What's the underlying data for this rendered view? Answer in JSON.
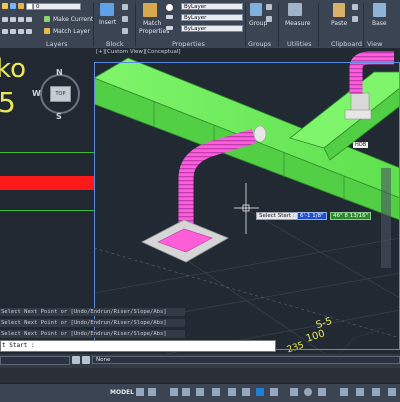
{
  "ribbon": {
    "layer_name": "0",
    "make_current": "Make Current",
    "match_layer": "Match Layer",
    "panel_layers": "Layers",
    "insert": "Insert",
    "panel_block": "Block",
    "match_properties_line1": "Match",
    "match_properties_line2": "Properties",
    "color_value": "ByLayer",
    "linetype_value": "ByLayer",
    "lineweight_value": "ByLayer",
    "panel_properties": "Properties",
    "group": "Group",
    "panel_groups": "Groups",
    "measure": "Measure",
    "panel_utilities": "Utilities",
    "paste": "Paste",
    "panel_clipboard": "Clipboard",
    "base": "Base",
    "panel_view": "View"
  },
  "left_panel": {
    "text_line1": "ko",
    "text_line2": "5",
    "viewcube_top": "TOP",
    "compass_n": "N",
    "compass_w": "W",
    "compass_s": "S"
  },
  "viewport": {
    "label": "[+][Custom View][Conceptual]",
    "tooltip_label": "Select Start :",
    "tooltip_value1": "6'-1 1/8\"",
    "tooltip_value2": "46° 8 13/16\"",
    "grid_label_1": "S-5",
    "grid_label_2": "100",
    "grid_label_3": "235",
    "duct_tag": "HOB"
  },
  "command_history": [
    "Select Next Point or [Undo/Endrun/Riser/Slope/Abs]",
    "Select Next Point or [Undo/Endrun/Riser/Slope/Abs]",
    "Select Next Point or [Undo/Endrun/Riser/Slope/Abs]"
  ],
  "command_prompt": "t Start :",
  "bottom_toolbar": {
    "filter_value": "None"
  },
  "status": {
    "model": "MODEL"
  },
  "colors": {
    "duct_green": "#6ee85a",
    "flex_pink": "#ff5ed9",
    "accent_red": "#ff1a1a",
    "tooltip_blue": "#1f4fd1",
    "tooltip_green": "#2c8a2c"
  }
}
